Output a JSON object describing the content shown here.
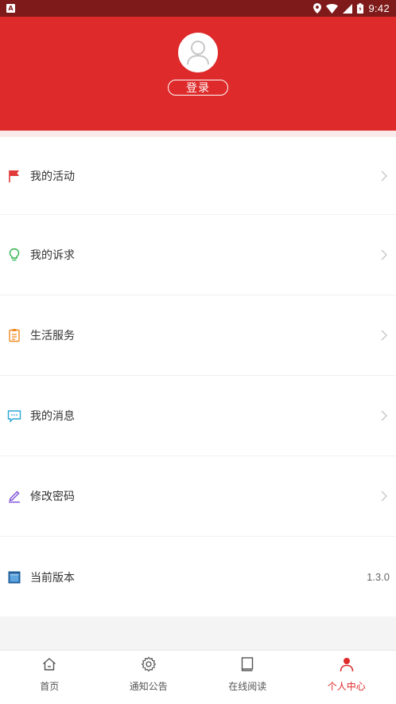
{
  "status_bar": {
    "time": "9:42",
    "left_badge": "A"
  },
  "header": {
    "login_label": "登录",
    "bg_color": "#de2a2a"
  },
  "menu": {
    "items": [
      {
        "label": "我的活动",
        "icon": "flag-icon"
      },
      {
        "label": "我的诉求",
        "icon": "lightbulb-icon"
      },
      {
        "label": "生活服务",
        "icon": "clipboard-icon"
      },
      {
        "label": "我的消息",
        "icon": "message-icon"
      },
      {
        "label": "修改密码",
        "icon": "pencil-icon"
      },
      {
        "label": "当前版本",
        "icon": "version-icon",
        "value": "1.3.0"
      }
    ]
  },
  "tabbar": {
    "tabs": [
      {
        "label": "首页",
        "icon": "home-icon"
      },
      {
        "label": "通知公告",
        "icon": "gear-icon"
      },
      {
        "label": "在线阅读",
        "icon": "book-icon"
      },
      {
        "label": "个人中心",
        "icon": "person-icon",
        "active": true
      }
    ],
    "active_color": "#de2a2a"
  }
}
